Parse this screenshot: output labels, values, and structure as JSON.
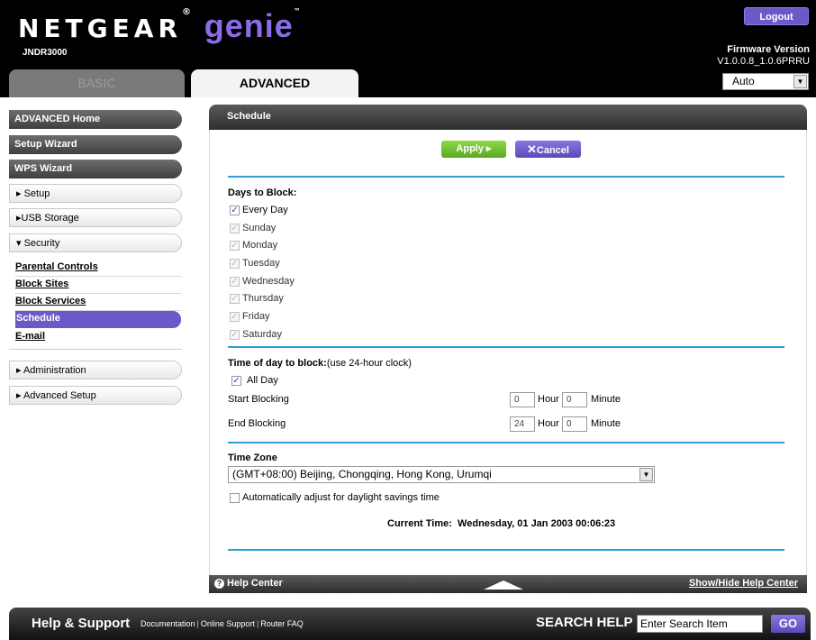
{
  "header": {
    "brand": "NETGEAR",
    "product": "genie",
    "model": "JNDR3000",
    "logout_label": "Logout",
    "firmware_label": "Firmware Version",
    "firmware_value": "V1.0.0.8_1.0.6PRRU",
    "tabs": [
      {
        "label": "BASIC",
        "active": false
      },
      {
        "label": "ADVANCED",
        "active": true
      }
    ],
    "language_select": "Auto"
  },
  "sidebar": {
    "top_items": [
      "ADVANCED Home",
      "Setup Wizard",
      "WPS Wizard"
    ],
    "sections": [
      {
        "label": "▸ Setup"
      },
      {
        "label": "▸USB Storage"
      },
      {
        "label": "▾ Security"
      }
    ],
    "security_items": [
      "Parental Controls",
      "Block Sites",
      "Block Services",
      "Schedule",
      "E-mail"
    ],
    "active_item": "Schedule",
    "bottom_sections": [
      {
        "label": "▸ Administration"
      },
      {
        "label": "▸ Advanced Setup"
      }
    ]
  },
  "main": {
    "title": "Schedule",
    "apply_label": "Apply ▸",
    "cancel_label": "Cancel",
    "days_heading": "Days to Block:",
    "days": [
      {
        "label": "Every Day",
        "checked": true,
        "enabled": true
      },
      {
        "label": "Sunday",
        "checked": true,
        "enabled": false
      },
      {
        "label": "Monday",
        "checked": true,
        "enabled": false
      },
      {
        "label": "Tuesday",
        "checked": true,
        "enabled": false
      },
      {
        "label": "Wednesday",
        "checked": true,
        "enabled": false
      },
      {
        "label": "Thursday",
        "checked": true,
        "enabled": false
      },
      {
        "label": "Friday",
        "checked": true,
        "enabled": false
      },
      {
        "label": "Saturday",
        "checked": true,
        "enabled": false
      }
    ],
    "time_heading": "Time of day to block:",
    "time_heading_note": "(use 24-hour clock)",
    "all_day_label": "All Day",
    "all_day_checked": true,
    "start_label": "Start Blocking",
    "start_hour": "0",
    "start_minute": "0",
    "end_label": "End Blocking",
    "end_hour": "24",
    "end_minute": "0",
    "hour_label": "Hour",
    "minute_label": "Minute",
    "timezone_heading": "Time Zone",
    "timezone_value": "(GMT+08:00) Beijing, Chongqing, Hong Kong, Urumqi",
    "dst_label": "Automatically adjust for daylight savings time",
    "dst_checked": false,
    "current_time_label": "Current Time:",
    "current_time_value": "Wednesday, 01 Jan 2003 00:06:23"
  },
  "help_bar": {
    "help_center_label": "Help Center",
    "show_hide_label": "Show/Hide Help Center"
  },
  "footer": {
    "title": "Help & Support",
    "links": [
      "Documentation",
      "Online Support",
      "Router FAQ"
    ],
    "search_label": "SEARCH HELP",
    "search_placeholder": "Enter Search Item",
    "go_label": "GO"
  },
  "colors": {
    "accent_purple": "#6d58c8",
    "apply_green": "#6cc12c",
    "rule_blue": "#2f9fd6"
  }
}
